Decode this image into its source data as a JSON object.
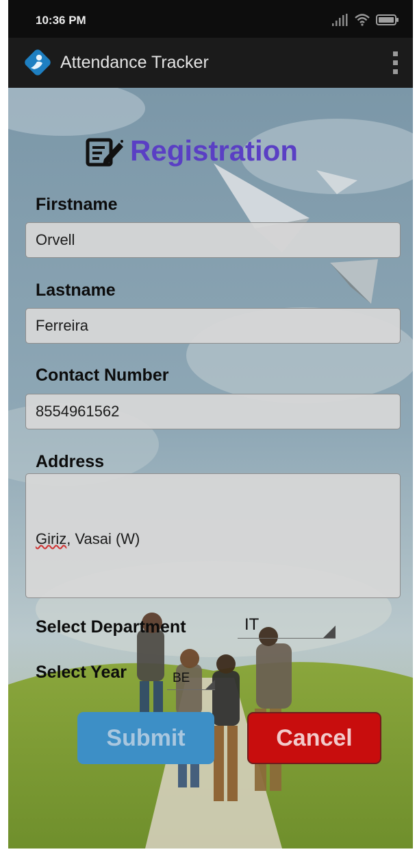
{
  "status_bar": {
    "time": "10:36 PM",
    "icons": [
      "signal-icon",
      "wifi-icon",
      "battery-icon"
    ]
  },
  "app_bar": {
    "title": "Attendance Tracker",
    "logo_icon": "attendance-logo-icon",
    "menu_icon": "overflow-menu-icon"
  },
  "form": {
    "heading": "Registration",
    "heading_icon": "edit-note-icon",
    "heading_color": "#5a3fc4",
    "firstname": {
      "label": "Firstname",
      "value": "Orvell"
    },
    "lastname": {
      "label": "Lastname",
      "value": "Ferreira"
    },
    "contact": {
      "label": "Contact Number",
      "value": "8554961562"
    },
    "address": {
      "label": "Address",
      "value_underlined": "Giriz",
      "value_rest": ", Vasai (W)"
    },
    "department": {
      "label": "Select Department",
      "value": "IT"
    },
    "year": {
      "label": "Select Year",
      "value": "BE"
    }
  },
  "buttons": {
    "submit": "Submit",
    "cancel": "Cancel",
    "submit_color": "#3d8fc6",
    "cancel_color": "#c80d0d"
  }
}
